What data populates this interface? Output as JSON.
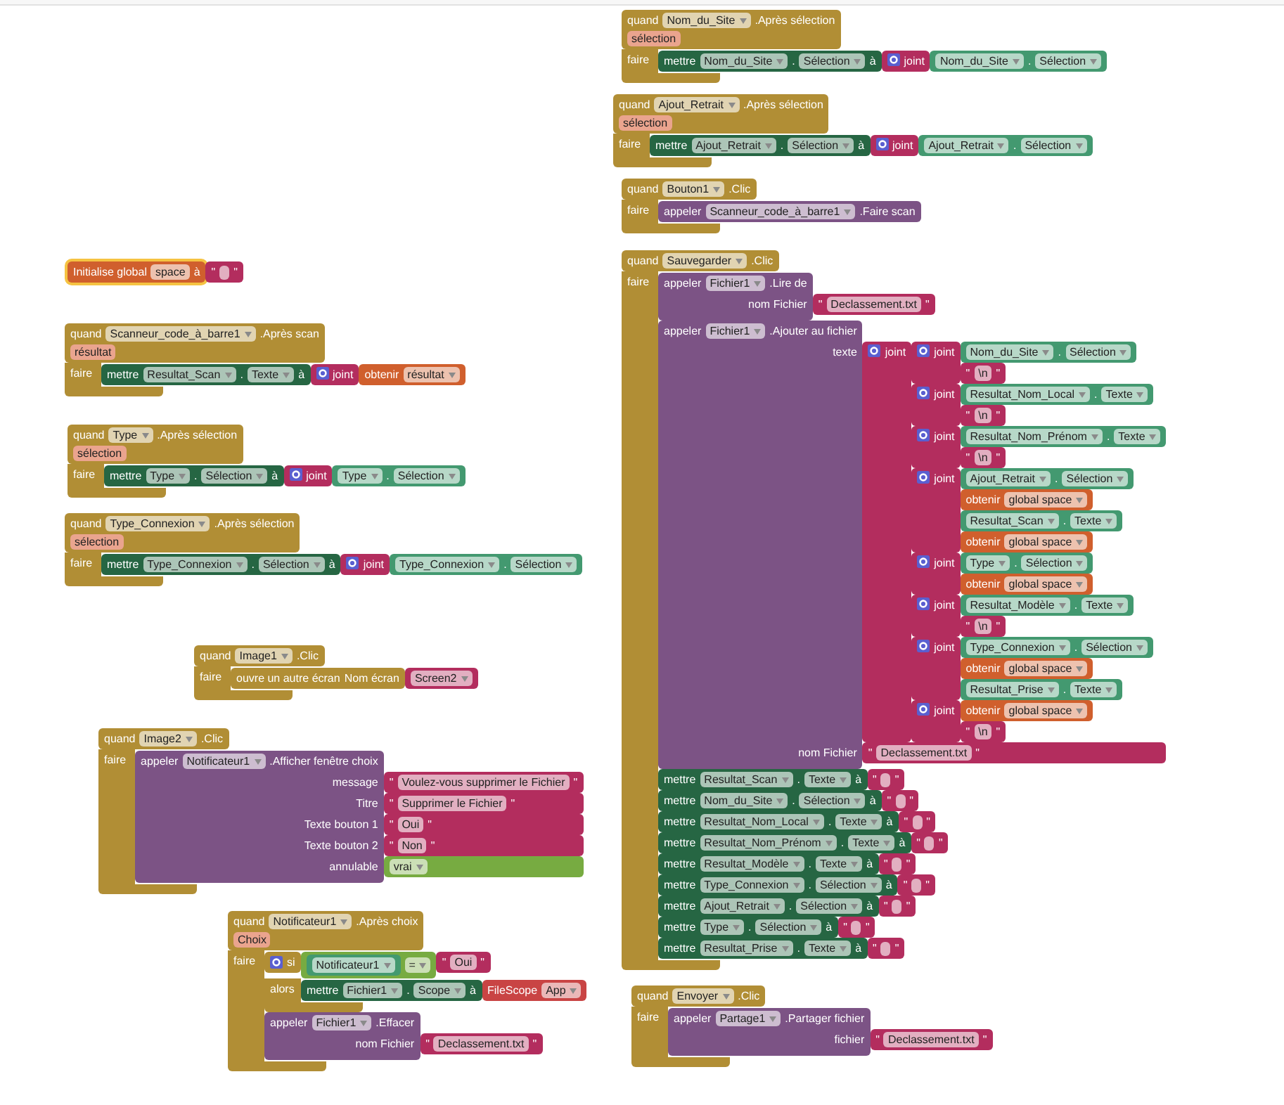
{
  "blocks": [
    {
      "kind": "global",
      "selected": true,
      "items": [
        "Initialise global",
        {
          "kind": "text",
          "text": "space"
        },
        "à",
        {
          "kind": "string",
          "items": [
            "\"",
            {
              "kind": "blank"
            },
            "\""
          ]
        }
      ]
    },
    {
      "kind": "event",
      "selected": false,
      "rows": [
        {
          "items": [
            "quand",
            {
              "kind": "dropdown",
              "text": "Scanneur_code_à_barre1"
            },
            ".Après scan"
          ]
        },
        {
          "items": [
            {
              "kind": "param",
              "text": "résultat"
            }
          ]
        },
        {
          "label": "faire",
          "stack": [
            {
              "kind": "set",
              "items": [
                "mettre",
                {
                  "kind": "dropdown",
                  "text": "Resultat_Scan"
                },
                ".",
                {
                  "kind": "dropdown",
                  "text": "Texte"
                },
                "à",
                {
                  "kind": "join",
                  "label": "joint",
                  "inputs": [
                    {
                      "kind": "get",
                      "items": [
                        "obtenir",
                        {
                          "kind": "dropdown",
                          "text": "résultat"
                        }
                      ]
                    }
                  ]
                }
              ]
            }
          ]
        }
      ]
    },
    {
      "kind": "event",
      "selected": false,
      "rows": [
        {
          "items": [
            "quand",
            {
              "kind": "dropdown",
              "text": "Type"
            },
            ".Après sélection"
          ]
        },
        {
          "items": [
            {
              "kind": "param",
              "text": "sélection"
            }
          ]
        },
        {
          "label": "faire",
          "stack": [
            {
              "kind": "set",
              "items": [
                "mettre",
                {
                  "kind": "dropdown",
                  "text": "Type"
                },
                ".",
                {
                  "kind": "dropdown",
                  "text": "Sélection"
                },
                "à",
                {
                  "kind": "join",
                  "label": "joint",
                  "inputs": [
                    {
                      "kind": "component",
                      "items": [
                        {
                          "kind": "dropdown",
                          "text": "Type"
                        },
                        ".",
                        {
                          "kind": "dropdown",
                          "text": "Sélection"
                        }
                      ]
                    }
                  ]
                }
              ]
            }
          ]
        }
      ]
    },
    {
      "kind": "event",
      "selected": false,
      "rows": [
        {
          "items": [
            "quand",
            {
              "kind": "dropdown",
              "text": "Type_Connexion"
            },
            ".Après sélection"
          ]
        },
        {
          "items": [
            {
              "kind": "param",
              "text": "sélection"
            }
          ]
        },
        {
          "label": "faire",
          "stack": [
            {
              "kind": "set",
              "items": [
                "mettre",
                {
                  "kind": "dropdown",
                  "text": "Type_Connexion"
                },
                ".",
                {
                  "kind": "dropdown",
                  "text": "Sélection"
                },
                "à",
                {
                  "kind": "join",
                  "label": "joint",
                  "inputs": [
                    {
                      "kind": "component",
                      "items": [
                        {
                          "kind": "dropdown",
                          "text": "Type_Connexion"
                        },
                        ".",
                        {
                          "kind": "dropdown",
                          "text": "Sélection"
                        }
                      ]
                    }
                  ]
                }
              ]
            }
          ]
        }
      ]
    },
    {
      "kind": "event",
      "selected": false,
      "rows": [
        {
          "items": [
            "quand",
            {
              "kind": "dropdown",
              "text": "Image1"
            },
            ".Clic"
          ]
        },
        {
          "label": "faire",
          "stack": [
            {
              "kind": "control",
              "items": [
                "ouvre un autre écran",
                "Nom écran",
                {
                  "kind": "string",
                  "items": [
                    {
                      "kind": "dropdown",
                      "text": "Screen2"
                    }
                  ]
                }
              ]
            }
          ]
        }
      ]
    },
    {
      "kind": "event",
      "selected": false,
      "rows": [
        {
          "items": [
            "quand",
            {
              "kind": "dropdown",
              "text": "Image2"
            },
            ".Clic"
          ]
        },
        {
          "label": "faire",
          "stack": [
            {
              "kind": "call",
              "rows": [
                {
                  "items": [
                    "appeler",
                    {
                      "kind": "dropdown",
                      "text": "Notificateur1"
                    },
                    ".Afficher fenêtre choix"
                  ]
                },
                {
                  "label": "message",
                  "input": {
                    "kind": "string",
                    "items": [
                      "\"",
                      {
                        "kind": "text",
                        "text": "Voulez-vous supprimer le Fichier"
                      },
                      "\""
                    ]
                  }
                },
                {
                  "label": "Titre",
                  "input": {
                    "kind": "string",
                    "items": [
                      "\"",
                      {
                        "kind": "text",
                        "text": "Supprimer le Fichier"
                      },
                      "\""
                    ]
                  }
                },
                {
                  "label": "Texte bouton 1",
                  "input": {
                    "kind": "string",
                    "items": [
                      "\"",
                      {
                        "kind": "text",
                        "text": "Oui"
                      },
                      "\""
                    ]
                  }
                },
                {
                  "label": "Texte bouton 2",
                  "input": {
                    "kind": "string",
                    "items": [
                      "\"",
                      {
                        "kind": "text",
                        "text": "Non"
                      },
                      "\""
                    ]
                  }
                },
                {
                  "label": "annulable",
                  "input": {
                    "kind": "logic",
                    "items": [
                      {
                        "kind": "dropdown",
                        "text": "vrai"
                      }
                    ]
                  }
                }
              ]
            }
          ]
        }
      ]
    },
    {
      "kind": "event",
      "selected": false,
      "rows": [
        {
          "items": [
            "quand",
            {
              "kind": "dropdown",
              "text": "Notificateur1"
            },
            ".Après choix"
          ]
        },
        {
          "items": [
            {
              "kind": "param",
              "text": "Choix"
            }
          ]
        },
        {
          "label": "faire",
          "stack": [
            {
              "kind": "if",
              "rows": [
                {
                  "items": [
                    "si",
                    {
                      "kind": "compare",
                      "items": [
                        {
                          "kind": "component",
                          "items": [
                            {
                              "kind": "dropdown",
                              "text": "Notificateur1"
                            }
                          ]
                        },
                        {
                          "kind": "dropdown",
                          "text": "="
                        },
                        {
                          "kind": "string",
                          "items": [
                            "\"",
                            {
                              "kind": "text",
                              "text": "Oui"
                            },
                            "\""
                          ]
                        }
                      ]
                    }
                  ]
                },
                {
                  "label": "alors",
                  "stack": [
                    {
                      "kind": "set",
                      "items": [
                        "mettre",
                        {
                          "kind": "dropdown",
                          "text": "Fichier1"
                        },
                        ".",
                        {
                          "kind": "dropdown",
                          "text": "Scope"
                        },
                        "à",
                        {
                          "kind": "helper",
                          "items": [
                            "FileScope",
                            {
                              "kind": "dropdown",
                              "text": "App"
                            }
                          ]
                        }
                      ]
                    }
                  ]
                }
              ]
            },
            {
              "kind": "call",
              "rows": [
                {
                  "items": [
                    "appeler",
                    {
                      "kind": "dropdown",
                      "text": "Fichier1"
                    },
                    ".Effacer"
                  ]
                },
                {
                  "label": "nom Fichier",
                  "input": {
                    "kind": "string",
                    "items": [
                      "\"",
                      {
                        "kind": "text",
                        "text": "Declassement.txt"
                      },
                      "\""
                    ]
                  }
                }
              ]
            }
          ]
        }
      ]
    },
    {
      "kind": "event",
      "selected": false,
      "rows": [
        {
          "items": [
            "quand",
            {
              "kind": "dropdown",
              "text": "Nom_du_Site"
            },
            ".Après sélection"
          ]
        },
        {
          "items": [
            {
              "kind": "param",
              "text": "sélection"
            }
          ]
        },
        {
          "label": "faire",
          "stack": [
            {
              "kind": "set",
              "items": [
                "mettre",
                {
                  "kind": "dropdown",
                  "text": "Nom_du_Site"
                },
                ".",
                {
                  "kind": "dropdown",
                  "text": "Sélection"
                },
                "à",
                {
                  "kind": "join",
                  "label": "joint",
                  "inputs": [
                    {
                      "kind": "component",
                      "items": [
                        {
                          "kind": "dropdown",
                          "text": "Nom_du_Site"
                        },
                        ".",
                        {
                          "kind": "dropdown",
                          "text": "Sélection"
                        }
                      ]
                    }
                  ]
                }
              ]
            }
          ]
        }
      ]
    },
    {
      "kind": "event",
      "selected": false,
      "rows": [
        {
          "items": [
            "quand",
            {
              "kind": "dropdown",
              "text": "Ajout_Retrait"
            },
            ".Après sélection"
          ]
        },
        {
          "items": [
            {
              "kind": "param",
              "text": "sélection"
            }
          ]
        },
        {
          "label": "faire",
          "stack": [
            {
              "kind": "set",
              "items": [
                "mettre",
                {
                  "kind": "dropdown",
                  "text": "Ajout_Retrait"
                },
                ".",
                {
                  "kind": "dropdown",
                  "text": "Sélection"
                },
                "à",
                {
                  "kind": "join",
                  "label": "joint",
                  "inputs": [
                    {
                      "kind": "component",
                      "items": [
                        {
                          "kind": "dropdown",
                          "text": "Ajout_Retrait"
                        },
                        ".",
                        {
                          "kind": "dropdown",
                          "text": "Sélection"
                        }
                      ]
                    }
                  ]
                }
              ]
            }
          ]
        }
      ]
    },
    {
      "kind": "event",
      "selected": false,
      "rows": [
        {
          "items": [
            "quand",
            {
              "kind": "dropdown",
              "text": "Bouton1"
            },
            ".Clic"
          ]
        },
        {
          "label": "faire",
          "stack": [
            {
              "kind": "call",
              "items": [
                "appeler",
                {
                  "kind": "dropdown",
                  "text": "Scanneur_code_à_barre1"
                },
                ".Faire scan"
              ]
            }
          ]
        }
      ]
    },
    {
      "kind": "event",
      "selected": false,
      "rows": [
        {
          "items": [
            "quand",
            {
              "kind": "dropdown",
              "text": "Sauvegarder"
            },
            ".Clic"
          ]
        },
        {
          "label": "faire",
          "stack": [
            {
              "kind": "call",
              "rows": [
                {
                  "items": [
                    "appeler",
                    {
                      "kind": "dropdown",
                      "text": "Fichier1"
                    },
                    ".Lire de"
                  ]
                },
                {
                  "label": "nom Fichier",
                  "input": {
                    "kind": "string",
                    "items": [
                      "\"",
                      {
                        "kind": "text",
                        "text": "Declassement.txt"
                      },
                      "\""
                    ]
                  }
                }
              ]
            },
            {
              "kind": "call",
              "rows": [
                {
                  "items": [
                    "appeler",
                    {
                      "kind": "dropdown",
                      "text": "Fichier1"
                    },
                    ".Ajouter au fichier"
                  ]
                },
                {
                  "label": "texte",
                  "input": {
                    "kind": "join",
                    "label": "joint",
                    "inputs": [
                      {
                        "kind": "join",
                        "label": "joint",
                        "inputs": [
                          {
                            "kind": "component",
                            "items": [
                              {
                                "kind": "dropdown",
                                "text": "Nom_du_Site"
                              },
                              ".",
                              {
                                "kind": "dropdown",
                                "text": "Sélection"
                              }
                            ]
                          },
                          {
                            "kind": "string",
                            "items": [
                              "\"",
                              {
                                "kind": "text",
                                "text": "\\n"
                              },
                              "\""
                            ]
                          }
                        ]
                      },
                      {
                        "kind": "join",
                        "label": "joint",
                        "inputs": [
                          {
                            "kind": "component",
                            "items": [
                              {
                                "kind": "dropdown",
                                "text": "Resultat_Nom_Local"
                              },
                              ".",
                              {
                                "kind": "dropdown",
                                "text": "Texte"
                              }
                            ]
                          },
                          {
                            "kind": "string",
                            "items": [
                              "\"",
                              {
                                "kind": "text",
                                "text": "\\n"
                              },
                              "\""
                            ]
                          }
                        ]
                      },
                      {
                        "kind": "join",
                        "label": "joint",
                        "inputs": [
                          {
                            "kind": "component",
                            "items": [
                              {
                                "kind": "dropdown",
                                "text": "Resultat_Nom_Prénom"
                              },
                              ".",
                              {
                                "kind": "dropdown",
                                "text": "Texte"
                              }
                            ]
                          },
                          {
                            "kind": "string",
                            "items": [
                              "\"",
                              {
                                "kind": "text",
                                "text": "\\n"
                              },
                              "\""
                            ]
                          }
                        ]
                      },
                      {
                        "kind": "join",
                        "label": "joint",
                        "inputs": [
                          {
                            "kind": "component",
                            "items": [
                              {
                                "kind": "dropdown",
                                "text": "Ajout_Retrait"
                              },
                              ".",
                              {
                                "kind": "dropdown",
                                "text": "Sélection"
                              }
                            ]
                          },
                          {
                            "kind": "get",
                            "items": [
                              "obtenir",
                              {
                                "kind": "dropdown",
                                "text": "global space"
                              }
                            ]
                          },
                          {
                            "kind": "component",
                            "items": [
                              {
                                "kind": "dropdown",
                                "text": "Resultat_Scan"
                              },
                              ".",
                              {
                                "kind": "dropdown",
                                "text": "Texte"
                              }
                            ]
                          },
                          {
                            "kind": "get",
                            "items": [
                              "obtenir",
                              {
                                "kind": "dropdown",
                                "text": "global space"
                              }
                            ]
                          }
                        ]
                      },
                      {
                        "kind": "join",
                        "label": "joint",
                        "inputs": [
                          {
                            "kind": "component",
                            "items": [
                              {
                                "kind": "dropdown",
                                "text": "Type"
                              },
                              ".",
                              {
                                "kind": "dropdown",
                                "text": "Sélection"
                              }
                            ]
                          },
                          {
                            "kind": "get",
                            "items": [
                              "obtenir",
                              {
                                "kind": "dropdown",
                                "text": "global space"
                              }
                            ]
                          }
                        ]
                      },
                      {
                        "kind": "join",
                        "label": "joint",
                        "inputs": [
                          {
                            "kind": "component",
                            "items": [
                              {
                                "kind": "dropdown",
                                "text": "Resultat_Modèle"
                              },
                              ".",
                              {
                                "kind": "dropdown",
                                "text": "Texte"
                              }
                            ]
                          },
                          {
                            "kind": "string",
                            "items": [
                              "\"",
                              {
                                "kind": "text",
                                "text": "\\n"
                              },
                              "\""
                            ]
                          }
                        ]
                      },
                      {
                        "kind": "join",
                        "label": "joint",
                        "inputs": [
                          {
                            "kind": "component",
                            "items": [
                              {
                                "kind": "dropdown",
                                "text": "Type_Connexion"
                              },
                              ".",
                              {
                                "kind": "dropdown",
                                "text": "Sélection"
                              }
                            ]
                          },
                          {
                            "kind": "get",
                            "items": [
                              "obtenir",
                              {
                                "kind": "dropdown",
                                "text": "global space"
                              }
                            ]
                          },
                          {
                            "kind": "component",
                            "items": [
                              {
                                "kind": "dropdown",
                                "text": "Resultat_Prise"
                              },
                              ".",
                              {
                                "kind": "dropdown",
                                "text": "Texte"
                              }
                            ]
                          }
                        ]
                      },
                      {
                        "kind": "join",
                        "label": "joint",
                        "inputs": [
                          {
                            "kind": "get",
                            "items": [
                              "obtenir",
                              {
                                "kind": "dropdown",
                                "text": "global space"
                              }
                            ]
                          },
                          {
                            "kind": "string",
                            "items": [
                              "\"",
                              {
                                "kind": "text",
                                "text": "\\n"
                              },
                              "\""
                            ]
                          }
                        ]
                      }
                    ]
                  }
                },
                {
                  "label": "nom Fichier",
                  "input": {
                    "kind": "string",
                    "items": [
                      "\"",
                      {
                        "kind": "text",
                        "text": "Declassement.txt"
                      },
                      "\""
                    ]
                  }
                }
              ]
            },
            {
              "kind": "set",
              "items": [
                "mettre",
                {
                  "kind": "dropdown",
                  "text": "Resultat_Scan"
                },
                ".",
                {
                  "kind": "dropdown",
                  "text": "Texte"
                },
                "à",
                {
                  "kind": "string",
                  "items": [
                    "\"",
                    {
                      "kind": "blank"
                    },
                    "\""
                  ]
                }
              ]
            },
            {
              "kind": "set",
              "items": [
                "mettre",
                {
                  "kind": "dropdown",
                  "text": "Nom_du_Site"
                },
                ".",
                {
                  "kind": "dropdown",
                  "text": "Sélection"
                },
                "à",
                {
                  "kind": "string",
                  "items": [
                    "\"",
                    {
                      "kind": "blank"
                    },
                    "\""
                  ]
                }
              ]
            },
            {
              "kind": "set",
              "items": [
                "mettre",
                {
                  "kind": "dropdown",
                  "text": "Resultat_Nom_Local"
                },
                ".",
                {
                  "kind": "dropdown",
                  "text": "Texte"
                },
                "à",
                {
                  "kind": "string",
                  "items": [
                    "\"",
                    {
                      "kind": "blank"
                    },
                    "\""
                  ]
                }
              ]
            },
            {
              "kind": "set",
              "items": [
                "mettre",
                {
                  "kind": "dropdown",
                  "text": "Resultat_Nom_Prénom"
                },
                ".",
                {
                  "kind": "dropdown",
                  "text": "Texte"
                },
                "à",
                {
                  "kind": "string",
                  "items": [
                    "\"",
                    {
                      "kind": "blank"
                    },
                    "\""
                  ]
                }
              ]
            },
            {
              "kind": "set",
              "items": [
                "mettre",
                {
                  "kind": "dropdown",
                  "text": "Resultat_Modèle"
                },
                ".",
                {
                  "kind": "dropdown",
                  "text": "Texte"
                },
                "à",
                {
                  "kind": "string",
                  "items": [
                    "\"",
                    {
                      "kind": "blank"
                    },
                    "\""
                  ]
                }
              ]
            },
            {
              "kind": "set",
              "items": [
                "mettre",
                {
                  "kind": "dropdown",
                  "text": "Type_Connexion"
                },
                ".",
                {
                  "kind": "dropdown",
                  "text": "Sélection"
                },
                "à",
                {
                  "kind": "string",
                  "items": [
                    "\"",
                    {
                      "kind": "blank"
                    },
                    "\""
                  ]
                }
              ]
            },
            {
              "kind": "set",
              "items": [
                "mettre",
                {
                  "kind": "dropdown",
                  "text": "Ajout_Retrait"
                },
                ".",
                {
                  "kind": "dropdown",
                  "text": "Sélection"
                },
                "à",
                {
                  "kind": "string",
                  "items": [
                    "\"",
                    {
                      "kind": "blank"
                    },
                    "\""
                  ]
                }
              ]
            },
            {
              "kind": "set",
              "items": [
                "mettre",
                {
                  "kind": "dropdown",
                  "text": "Type"
                },
                ".",
                {
                  "kind": "dropdown",
                  "text": "Sélection"
                },
                "à",
                {
                  "kind": "string",
                  "items": [
                    "\"",
                    {
                      "kind": "blank"
                    },
                    "\""
                  ]
                }
              ]
            },
            {
              "kind": "set",
              "items": [
                "mettre",
                {
                  "kind": "dropdown",
                  "text": "Resultat_Prise"
                },
                ".",
                {
                  "kind": "dropdown",
                  "text": "Texte"
                },
                "à",
                {
                  "kind": "string",
                  "items": [
                    "\"",
                    {
                      "kind": "blank"
                    },
                    "\""
                  ]
                }
              ]
            }
          ]
        }
      ]
    },
    {
      "kind": "event",
      "selected": false,
      "rows": [
        {
          "items": [
            "quand",
            {
              "kind": "dropdown",
              "text": "Envoyer"
            },
            ".Clic"
          ]
        },
        {
          "label": "faire",
          "stack": [
            {
              "kind": "call",
              "rows": [
                {
                  "items": [
                    "appeler",
                    {
                      "kind": "dropdown",
                      "text": "Partage1"
                    },
                    ".Partager fichier"
                  ]
                },
                {
                  "label": "fichier",
                  "input": {
                    "kind": "string",
                    "items": [
                      "\"",
                      {
                        "kind": "text",
                        "text": "Declassement.txt"
                      },
                      "\""
                    ]
                  }
                }
              ]
            }
          ]
        }
      ]
    }
  ]
}
